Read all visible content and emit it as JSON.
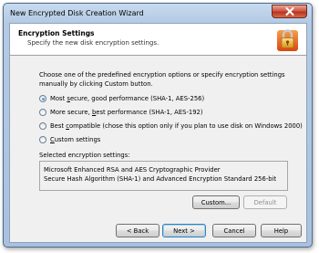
{
  "window": {
    "title": "New Encrypted Disk Creation Wizard"
  },
  "header": {
    "title": "Encryption Settings",
    "subtitle": "Specify the new disk encryption settings."
  },
  "description": {
    "line1": "Choose one of the predefined encryption options or specify encryption settings",
    "line2": "manually by clicking Custom button."
  },
  "options": [
    {
      "label": "Most secure, good performance (SHA-1, AES-256)",
      "checked": true
    },
    {
      "label": "More secure, best performance (SHA-1, AES-192)",
      "checked": false
    },
    {
      "label": "Best compatible (chose this option only if you plan to use disk on Windows 2000)",
      "checked": false
    },
    {
      "label": "Custom settings",
      "checked": false
    }
  ],
  "selected": {
    "label": "Selected encryption settings:",
    "line1": "Microsoft Enhanced RSA and AES Cryptographic Provider",
    "line2": "Secure Hash Algorithm (SHA-1) and Advanced Encryption Standard 256-bit"
  },
  "buttons": {
    "custom": "Custom...",
    "default": "Default",
    "back": "< Back",
    "next": "Next >",
    "cancel": "Cancel",
    "help": "Help"
  },
  "colors": {
    "accent": "#3c7fb1",
    "close_button": "#c8412b",
    "lock_gold": "#e8a320",
    "header_icon_bg": "#e85c1c"
  },
  "icons": {
    "header": "padlock-icon",
    "close": "close-icon"
  }
}
